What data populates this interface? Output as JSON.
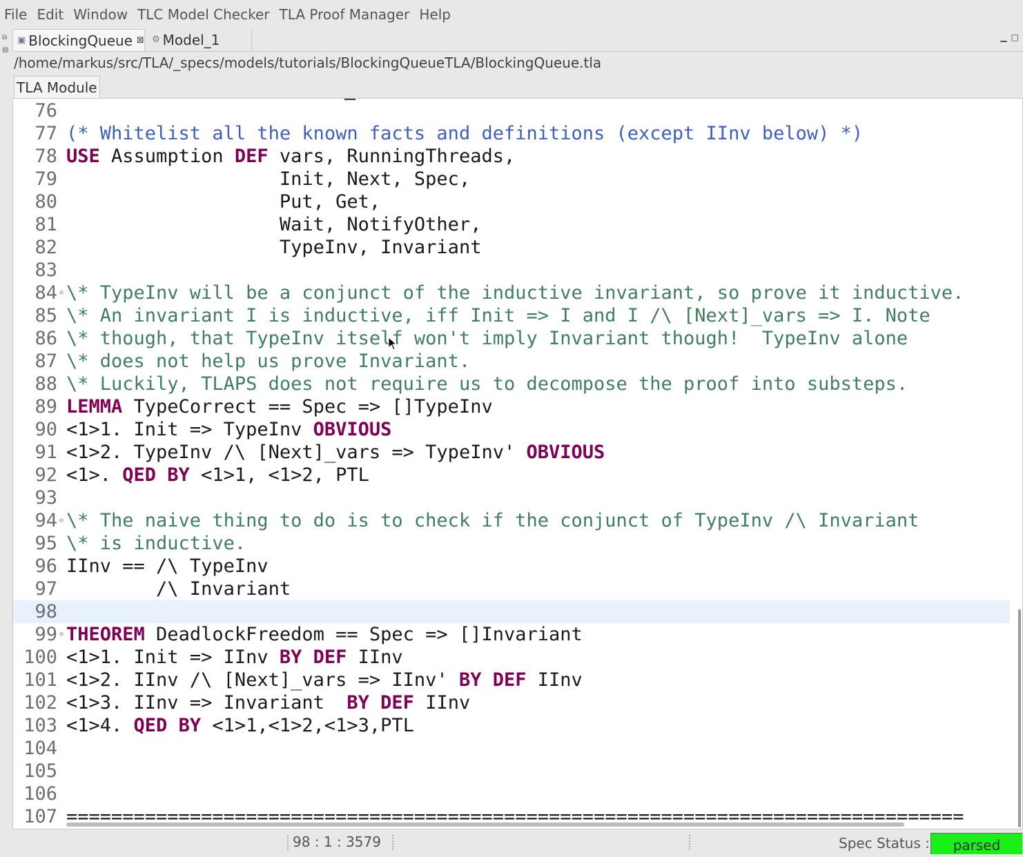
{
  "menu": [
    "File",
    "Edit",
    "Window",
    "TLC Model Checker",
    "TLA Proof Manager",
    "Help"
  ],
  "tabs": [
    {
      "label": "BlockingQueue",
      "close": "⊠"
    },
    {
      "label": "Model_1"
    }
  ],
  "path": "/home/markus/src/TLA/_specs/models/tutorials/BlockingQueueTLA/BlockingQueue.tla",
  "module_tab": "TLA Module",
  "code_lines": [
    {
      "n": "76",
      "segs": []
    },
    {
      "n": "77",
      "segs": [
        {
          "c": "mc",
          "t": "(* Whitelist all the known facts and definitions (except IInv below) *)"
        }
      ]
    },
    {
      "n": "78",
      "segs": [
        {
          "c": "kw",
          "t": "USE"
        },
        {
          "c": "",
          "t": " Assumption "
        },
        {
          "c": "kw",
          "t": "DEF"
        },
        {
          "c": "",
          "t": " vars, RunningThreads,"
        }
      ]
    },
    {
      "n": "79",
      "segs": [
        {
          "c": "",
          "t": "                   Init, Next, Spec,"
        }
      ]
    },
    {
      "n": "80",
      "segs": [
        {
          "c": "",
          "t": "                   Put, Get,"
        }
      ]
    },
    {
      "n": "81",
      "segs": [
        {
          "c": "",
          "t": "                   Wait, NotifyOther,"
        }
      ]
    },
    {
      "n": "82",
      "segs": [
        {
          "c": "",
          "t": "                   TypeInv, Invariant"
        }
      ]
    },
    {
      "n": "83",
      "segs": []
    },
    {
      "n": "84",
      "fold": true,
      "segs": [
        {
          "c": "cm",
          "t": "\\* TypeInv will be a conjunct of the inductive invariant, so prove it inductive."
        }
      ]
    },
    {
      "n": "85",
      "segs": [
        {
          "c": "cm",
          "t": "\\* An invariant I is inductive, iff Init => I and I /\\ [Next]_vars => I. Note"
        }
      ]
    },
    {
      "n": "86",
      "segs": [
        {
          "c": "cm",
          "t": "\\* though, that TypeInv itself won't imply Invariant though!  TypeInv alone"
        }
      ]
    },
    {
      "n": "87",
      "segs": [
        {
          "c": "cm",
          "t": "\\* does not help us prove Invariant."
        }
      ]
    },
    {
      "n": "88",
      "segs": [
        {
          "c": "cm",
          "t": "\\* Luckily, TLAPS does not require us to decompose the proof into substeps."
        }
      ]
    },
    {
      "n": "89",
      "segs": [
        {
          "c": "kw",
          "t": "LEMMA"
        },
        {
          "c": "",
          "t": " TypeCorrect == Spec => []TypeInv"
        }
      ]
    },
    {
      "n": "90",
      "segs": [
        {
          "c": "",
          "t": "<1>1. Init => TypeInv "
        },
        {
          "c": "kw",
          "t": "OBVIOUS"
        }
      ]
    },
    {
      "n": "91",
      "segs": [
        {
          "c": "",
          "t": "<1>2. TypeInv /\\ [Next]_vars => TypeInv' "
        },
        {
          "c": "kw",
          "t": "OBVIOUS"
        }
      ]
    },
    {
      "n": "92",
      "segs": [
        {
          "c": "",
          "t": "<1>. "
        },
        {
          "c": "kw",
          "t": "QED BY"
        },
        {
          "c": "",
          "t": " <1>1, <1>2, PTL"
        }
      ]
    },
    {
      "n": "93",
      "segs": []
    },
    {
      "n": "94",
      "fold": true,
      "segs": [
        {
          "c": "cm",
          "t": "\\* The naive thing to do is to check if the conjunct of TypeInv /\\ Invariant"
        }
      ]
    },
    {
      "n": "95",
      "segs": [
        {
          "c": "cm",
          "t": "\\* is inductive."
        }
      ]
    },
    {
      "n": "96",
      "segs": [
        {
          "c": "",
          "t": "IInv == /\\ TypeInv"
        }
      ]
    },
    {
      "n": "97",
      "segs": [
        {
          "c": "",
          "t": "        /\\ Invariant"
        }
      ]
    },
    {
      "n": "98",
      "current": true,
      "segs": []
    },
    {
      "n": "99",
      "fold": true,
      "segs": [
        {
          "c": "kw",
          "t": "THEOREM"
        },
        {
          "c": "",
          "t": " DeadlockFreedom == Spec => []Invariant"
        }
      ]
    },
    {
      "n": "100",
      "segs": [
        {
          "c": "",
          "t": "<1>1. Init => IInv "
        },
        {
          "c": "kw",
          "t": "BY DEF"
        },
        {
          "c": "",
          "t": " IInv"
        }
      ]
    },
    {
      "n": "101",
      "segs": [
        {
          "c": "",
          "t": "<1>2. IInv /\\ [Next]_vars => IInv' "
        },
        {
          "c": "kw",
          "t": "BY DEF"
        },
        {
          "c": "",
          "t": " IInv"
        }
      ]
    },
    {
      "n": "102",
      "segs": [
        {
          "c": "",
          "t": "<1>3. IInv => Invariant  "
        },
        {
          "c": "kw",
          "t": "BY DEF"
        },
        {
          "c": "",
          "t": " IInv"
        }
      ]
    },
    {
      "n": "103",
      "segs": [
        {
          "c": "",
          "t": "<1>4. "
        },
        {
          "c": "kw",
          "t": "QED BY"
        },
        {
          "c": "",
          "t": " <1>1,<1>2,<1>3,PTL"
        }
      ]
    },
    {
      "n": "104",
      "segs": []
    },
    {
      "n": "105",
      "segs": []
    },
    {
      "n": "106",
      "segs": []
    },
    {
      "n": "107",
      "segs": [
        {
          "c": "",
          "t": "================================================================================"
        }
      ]
    }
  ],
  "status": {
    "cursor": "98 : 1 : 3579",
    "spec_label": "Spec Status :",
    "spec_value": "parsed"
  },
  "colors": {
    "keyword": "#7f0055",
    "comment": "#3f7f5f",
    "multiline_comment": "#3f5fbf",
    "current_line": "#e8f2fe",
    "status_parsed": "#19f019"
  },
  "icons": [
    "restore-icon",
    "package-icon",
    "module-file-icon",
    "model-icon",
    "close-icon",
    "minimize-icon",
    "maximize-icon",
    "fold-icon",
    "mouse-cursor-icon"
  ]
}
